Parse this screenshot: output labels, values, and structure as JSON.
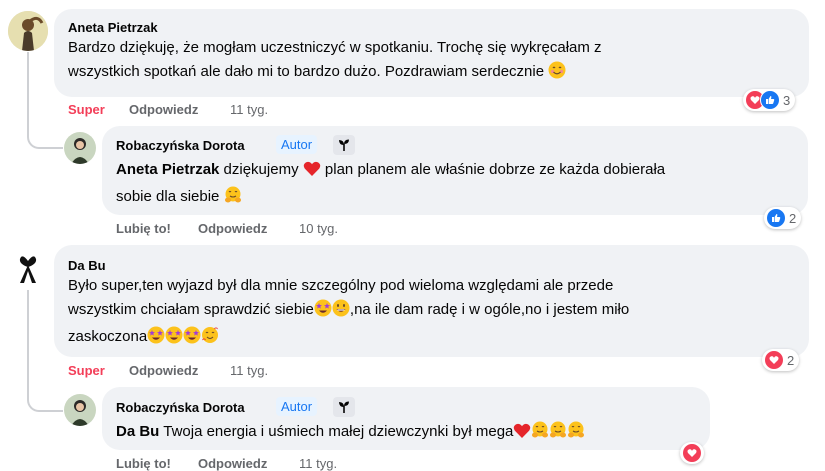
{
  "comments": [
    {
      "author": "Aneta Pietrzak",
      "text": "Bardzo dziękuję, że mogłam uczestniczyć w spotkaniu. Trochę się wykręcałam z wszystkich spotkań ale dało mi to bardzo dużo. Pozdrawiam serdecznie",
      "text_line1": "Bardzo dziękuję, że mogłam uczestniczyć w spotkaniu. Trochę się wykręcałam z",
      "text_line2": "wszystkich spotkań ale dało mi to bardzo dużo. Pozdrawiam serdecznie",
      "react_label": "Super",
      "reply_label": "Odpowiedz",
      "time": "11 tyg.",
      "reaction_count": "3",
      "reactions": [
        "heart-reaction",
        "like-reaction"
      ],
      "reply": {
        "author": "Robaczyńska Dorota",
        "author_badge": "Autor",
        "mention": "Aneta Pietrzak",
        "text_line1": " dziękujemy ",
        "text_line1b": " plan planem ale właśnie dobrze ze każda dobierała",
        "text_line2": "sobie dla siebie ",
        "react_label": "Lubię to!",
        "reply_label": "Odpowiedz",
        "time": "10 tyg.",
        "reaction_count": "2",
        "reactions": [
          "like-reaction"
        ]
      }
    },
    {
      "author": "Da Bu",
      "text_line1": "Było super,ten wyjazd był dla mnie szczególny pod wieloma względami ale przede",
      "text_line2a": "wszystkim chciałam sprawdzić siebie",
      "text_line2b": ",na ile dam radę i w ogóle,no i jestem miło",
      "text_line3": "zaskoczona",
      "react_label": "Super",
      "reply_label": "Odpowiedz",
      "time": "11 tyg.",
      "reaction_count": "2",
      "reactions": [
        "heart-reaction"
      ],
      "reply": {
        "author": "Robaczyńska Dorota",
        "author_badge": "Autor",
        "mention": "Da Bu",
        "text": " Twoja energia i uśmiech małej dziewczynki był mega",
        "react_label": "Lubię to!",
        "reply_label": "Odpowiedz",
        "time": "11 tyg.",
        "reactions": [
          "heart-reaction"
        ]
      }
    }
  ],
  "colors": {
    "bubble": "#f0f2f5",
    "secondary_text": "#65676b",
    "super_red": "#f33e58",
    "like_blue": "#1877f2",
    "autor_bg": "#e7f3ff"
  }
}
